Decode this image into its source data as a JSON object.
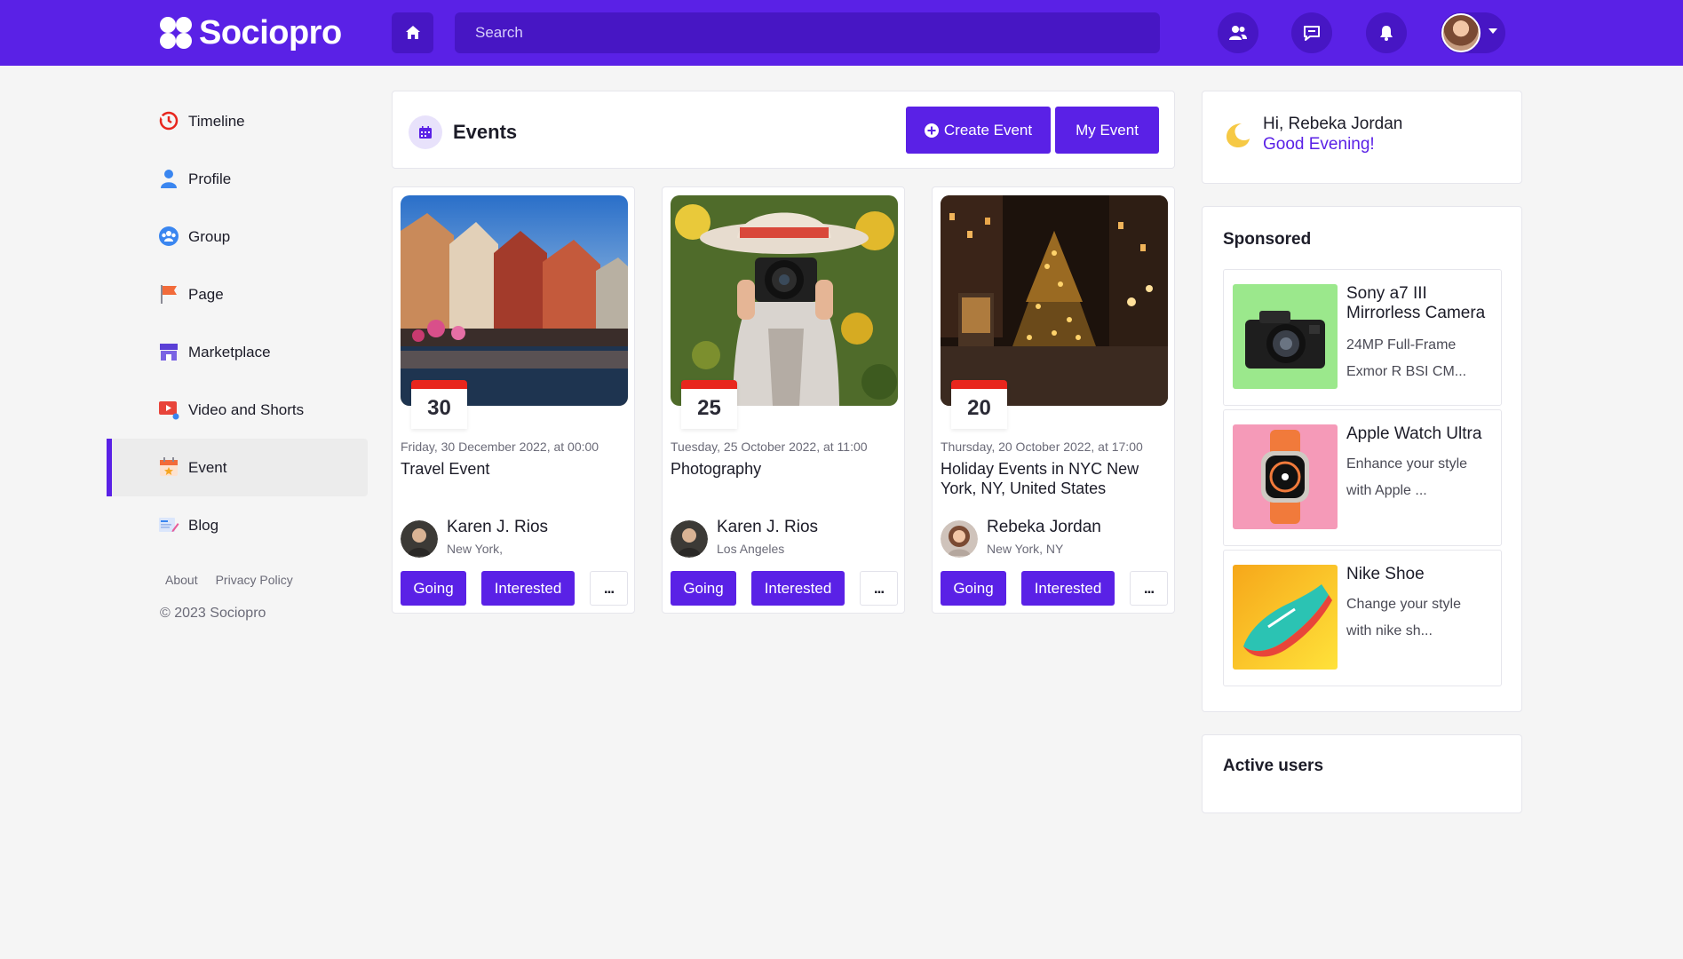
{
  "app": {
    "name": "Sociopro",
    "search_placeholder": "Search"
  },
  "colors": {
    "brand": "#5a21e6",
    "brand_dark": "#4716c4",
    "date_accent": "#e8261d"
  },
  "header_icons": [
    "home-icon",
    "friends-icon",
    "messages-icon",
    "bell-icon",
    "user-avatar"
  ],
  "sidebar": {
    "items": [
      {
        "label": "Timeline",
        "icon": "history-icon",
        "active": false
      },
      {
        "label": "Profile",
        "icon": "person-icon",
        "active": false
      },
      {
        "label": "Group",
        "icon": "group-icon",
        "active": false
      },
      {
        "label": "Page",
        "icon": "flag-icon",
        "active": false
      },
      {
        "label": "Marketplace",
        "icon": "store-icon",
        "active": false
      },
      {
        "label": "Video and Shorts",
        "icon": "video-icon",
        "active": false
      },
      {
        "label": "Event",
        "icon": "calendar-icon",
        "active": true
      },
      {
        "label": "Blog",
        "icon": "blog-icon",
        "active": false
      }
    ],
    "links": [
      "About",
      "Privacy Policy"
    ],
    "copyright": "© 2023 Sociopro"
  },
  "events": {
    "title": "Events",
    "create_label": "Create Event",
    "my_label": "My Event",
    "cards": [
      {
        "day": "30",
        "date": "Friday, 30 December 2022, at 00:00",
        "title": "Travel Event",
        "host": "Karen J. Rios",
        "location": "New York,",
        "going": "Going",
        "interested": "Interested",
        "more": "..."
      },
      {
        "day": "25",
        "date": "Tuesday, 25 October 2022, at 11:00",
        "title": "Photography",
        "host": "Karen J. Rios",
        "location": "Los Angeles",
        "going": "Going",
        "interested": "Interested",
        "more": "..."
      },
      {
        "day": "20",
        "date": "Thursday, 20 October 2022, at 17:00",
        "title": "Holiday Events in NYC New York, NY, United States",
        "host": "Rebeka Jordan",
        "location": "New York, NY",
        "going": "Going",
        "interested": "Interested",
        "more": "..."
      }
    ]
  },
  "greeting": {
    "hi": "Hi, Rebeka Jordan",
    "sub": "Good Evening!"
  },
  "sponsored": {
    "title": "Sponsored",
    "items": [
      {
        "name": "Sony a7 III Mirrorless Camera",
        "desc": "24MP Full-Frame Exmor R BSI CM..."
      },
      {
        "name": "Apple Watch Ultra",
        "desc": "Enhance your style with Apple ..."
      },
      {
        "name": "Nike Shoe",
        "desc": "Change your style with nike sh..."
      }
    ]
  },
  "active_users": {
    "title": "Active users"
  }
}
